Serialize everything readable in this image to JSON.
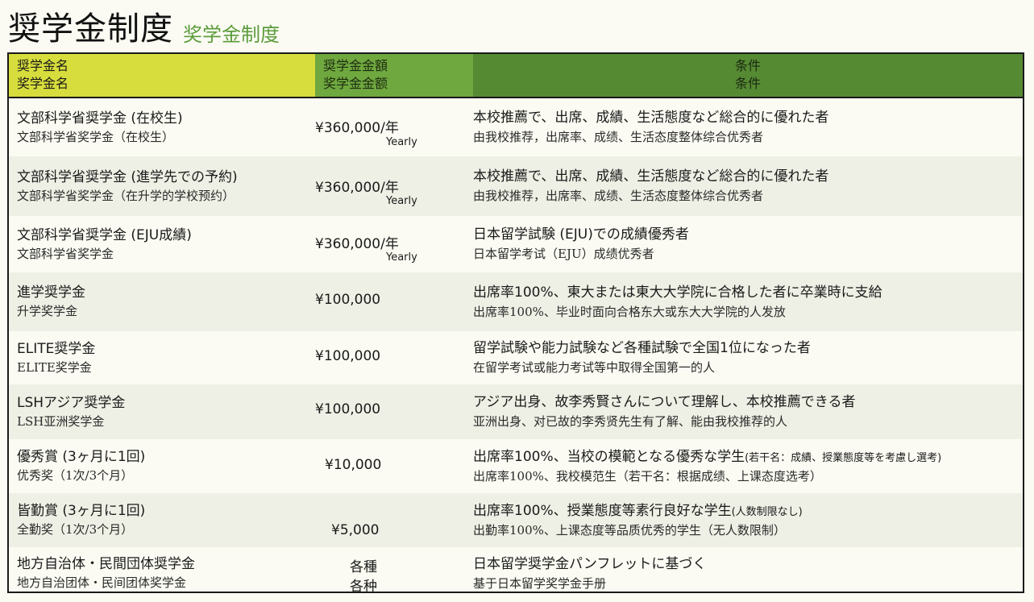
{
  "title": {
    "main": "奨学金制度",
    "sub": "奖学金制度"
  },
  "header": {
    "name_ja": "奨学金名",
    "name_zh": "奖学金名",
    "amount_ja": "奨学金金額",
    "amount_zh": "奖学金金额",
    "cond_ja": "条件",
    "cond_zh": "条件"
  },
  "rows": [
    {
      "name_ja": "文部科学省奨学金 (在校生)",
      "name_zh": "文部科学省奖学金（在校生）",
      "amount": "¥360,000/年",
      "unit": "Yearly",
      "cond_ja": "本校推薦で、出席、成績、生活態度など総合的に優れた者",
      "cond_ja_note": "",
      "cond_zh": "由我校推荐，出席率、成绩、生活态度整体综合优秀者"
    },
    {
      "name_ja": "文部科学省奨学金 (進学先での予約)",
      "name_zh": "文部科学省奖学金（在升学的学校预约）",
      "amount": "¥360,000/年",
      "unit": "Yearly",
      "cond_ja": "本校推薦で、出席、成績、生活態度など総合的に優れた者",
      "cond_ja_note": "",
      "cond_zh": "由我校推荐，出席率、成绩、生活态度整体综合优秀者"
    },
    {
      "name_ja": "文部科学省奨学金 (EJU成績)",
      "name_zh": "文部科学省奖学金",
      "amount": "¥360,000/年",
      "unit": "Yearly",
      "cond_ja": "日本留学試験 (EJU)での成績優秀者",
      "cond_ja_note": "",
      "cond_zh": "日本留学考试（EJU）成绩优秀者"
    },
    {
      "name_ja": "進学奨学金",
      "name_zh": "升学奖学金",
      "amount": "¥100,000",
      "unit": "",
      "cond_ja": "出席率100%、東大または東大大学院に合格した者に卒業時に支給",
      "cond_ja_note": "",
      "cond_zh": "出席率100%、毕业时面向合格东大或东大大学院的人发放"
    },
    {
      "name_ja": "ELITE奨学金",
      "name_zh": "ELITE奖学金",
      "amount": "¥100,000",
      "unit": "",
      "cond_ja": "留学試験や能力試験など各種試験で全国1位になった者",
      "cond_ja_note": "",
      "cond_zh": "在留学考试或能力考试等中取得全国第一的人"
    },
    {
      "name_ja": "LSHアジア奨学金",
      "name_zh": "LSH亚洲奖学金",
      "amount": "¥100,000",
      "unit": "",
      "cond_ja": "アジア出身、故李秀賢さんについて理解し、本校推薦できる者",
      "cond_ja_note": "",
      "cond_zh": "亚洲出身、对已故的李秀贤先生有了解、能由我校推荐的人"
    },
    {
      "name_ja": "優秀賞 (3ヶ月に1回)",
      "name_zh": "优秀奖（1次/3个月）",
      "amount": "¥10,000",
      "unit": "",
      "cond_ja": "出席率100%、当校の模範となる優秀な学生",
      "cond_ja_note": "(若干名：成績、授業態度等を考慮し選考)",
      "cond_zh": "出席率100%、我校模范生（若干名：根据成绩、上课态度选考）"
    },
    {
      "name_ja": "皆勤賞 (3ヶ月に1回)",
      "name_zh": "全勤奖（1次/3个月）",
      "amount": "¥5,000",
      "unit": "",
      "cond_ja": "出席率100%、授業態度等素行良好な学生",
      "cond_ja_note": "(人数制限なし)",
      "cond_zh": "出勤率100%、上课态度等品质优秀的学生（无人数限制）"
    },
    {
      "name_ja": "地方自治体・民間団体奨学金",
      "name_zh": "地方自治团体・民间团体奖学金",
      "amount": "各種",
      "unit": "各种",
      "cond_ja": "日本留学奨学金パンフレットに基づく",
      "cond_ja_note": "",
      "cond_zh": "基于日本留学奖学金手册"
    }
  ]
}
